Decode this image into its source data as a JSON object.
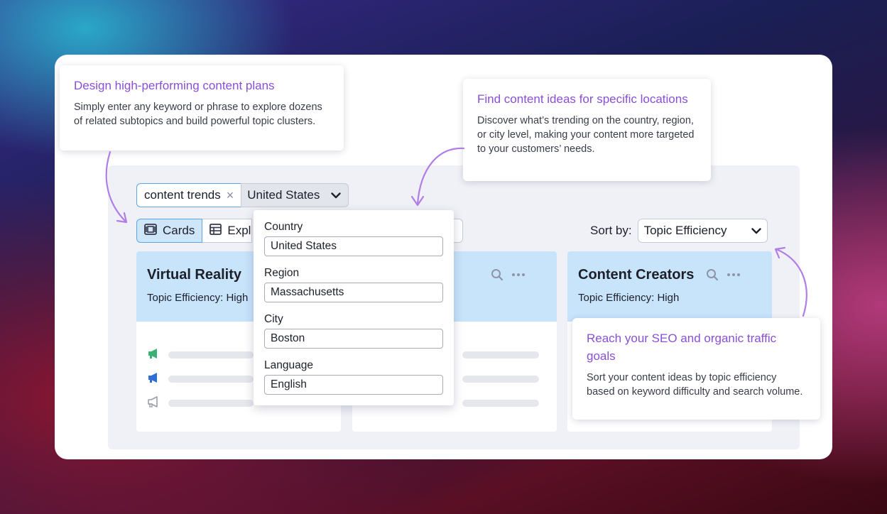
{
  "callouts": {
    "plans": {
      "title": "Design high-performing content plans",
      "body": "Simply enter any keyword or phrase to explore dozens of related subtopics and build powerful topic clusters."
    },
    "locations": {
      "title": "Find content ideas for specific locations",
      "body": "Discover what’s trending on the country, region, or city level, making your content more targeted to your customers’ needs."
    },
    "seo": {
      "title": "Reach your SEO and organic traffic goals",
      "body": "Sort your content ideas by topic efficiency based on keyword difficulty and search volume."
    }
  },
  "search": {
    "keyword": "content trends",
    "clear_icon": "×",
    "location": "United States",
    "chevron_icon": "⌄"
  },
  "view_tabs": {
    "cards": "Cards",
    "explorer": "Expl"
  },
  "sort": {
    "label": "Sort by:",
    "value": "Topic Efficiency",
    "chevron_icon": "⌄"
  },
  "location_dropdown": {
    "country_label": "Country",
    "country_value": "United States",
    "region_label": "Region",
    "region_value": "Massachusetts",
    "city_label": "City",
    "city_value": "Boston",
    "language_label": "Language",
    "language_value": "English"
  },
  "topic_cards": [
    {
      "title": "Virtual Reality",
      "efficiency": "Topic Efficiency: High"
    },
    {
      "title": "",
      "efficiency": ""
    },
    {
      "title": "Content Creators",
      "efficiency": "Topic Efficiency: High"
    }
  ],
  "colors": {
    "accent_purple": "#8a4fd6",
    "card_header_blue": "#c7e4fb",
    "megaphone_green": "#3bb273",
    "megaphone_blue": "#2d6fd6",
    "megaphone_gray": "#9a9eab"
  }
}
